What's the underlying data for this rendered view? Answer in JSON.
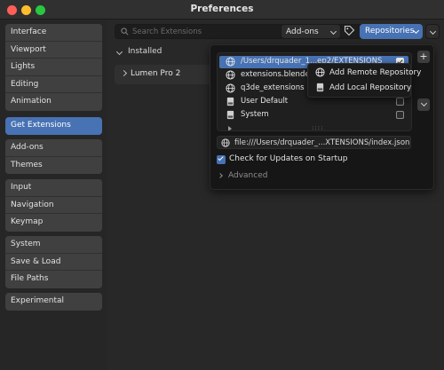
{
  "window": {
    "title": "Preferences"
  },
  "sidebar": {
    "groups": [
      [
        {
          "label": "Interface"
        },
        {
          "label": "Viewport"
        },
        {
          "label": "Lights"
        },
        {
          "label": "Editing"
        },
        {
          "label": "Animation"
        }
      ],
      [
        {
          "label": "Get Extensions",
          "active": true
        }
      ],
      [
        {
          "label": "Add-ons"
        },
        {
          "label": "Themes"
        }
      ],
      [
        {
          "label": "Input"
        },
        {
          "label": "Navigation"
        },
        {
          "label": "Keymap"
        }
      ],
      [
        {
          "label": "System"
        },
        {
          "label": "Save & Load"
        },
        {
          "label": "File Paths"
        }
      ],
      [
        {
          "label": "Experimental"
        }
      ]
    ]
  },
  "header": {
    "search_placeholder": "Search Extensions",
    "filter_selected": "Add-ons",
    "repositories_label": "Repositories"
  },
  "installed": {
    "section_label": "Installed",
    "packages": [
      {
        "label": "Lumen Pro 2"
      }
    ]
  },
  "repositories_popup": {
    "items": [
      {
        "label": "/Users/drquader_1...ep2/EXTENSIONS",
        "icon": "globe-icon",
        "enabled": true,
        "selected": true
      },
      {
        "label": "extensions.blender.org",
        "icon": "globe-icon",
        "enabled": null
      },
      {
        "label": "q3de_extensions",
        "icon": "globe-icon",
        "enabled": null
      },
      {
        "label": "User Default",
        "icon": "disk-icon",
        "enabled": false
      },
      {
        "label": "System",
        "icon": "disk-icon",
        "enabled": false
      }
    ],
    "add_button": "+",
    "url_value": "file:///Users/drquader_...XTENSIONS/index.json",
    "check_updates_label": "Check for Updates on Startup",
    "check_updates_checked": true,
    "advanced_label": "Advanced",
    "grip": "::::"
  },
  "add_menu": {
    "items": [
      {
        "label": "Add Remote Repository",
        "icon": "globe-icon"
      },
      {
        "label": "Add Local Repository",
        "icon": "disk-icon"
      }
    ]
  },
  "colors": {
    "accent": "#4772b3",
    "background": "#282828",
    "sidebar": "#262626"
  }
}
